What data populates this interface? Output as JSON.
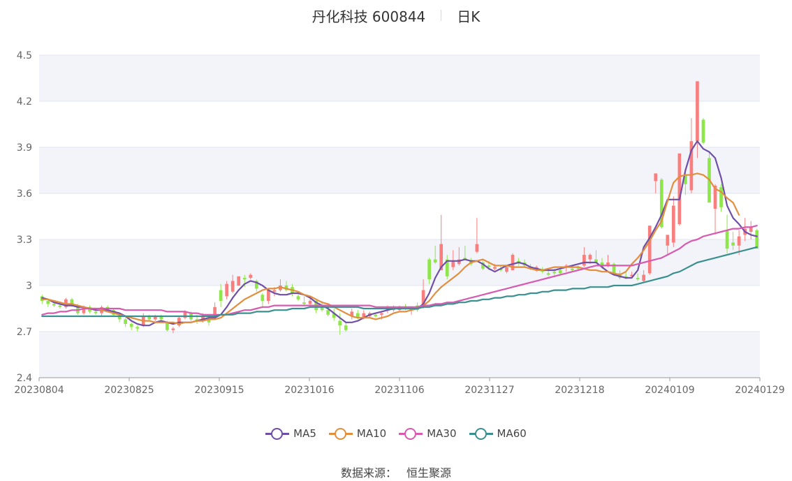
{
  "header": {
    "title": "丹化科技 600844",
    "period": "日K"
  },
  "source": {
    "label": "数据来源：",
    "value": "恒生聚源"
  },
  "chart_data": {
    "type": "candlestick",
    "ylim": [
      2.4,
      4.5
    ],
    "yticks": [
      "2.4",
      "2.7",
      "3",
      "3.3",
      "3.6",
      "3.9",
      "4.2",
      "4.5"
    ],
    "xticks": [
      "20230804",
      "20230825",
      "20230915",
      "20231016",
      "20231106",
      "20231127",
      "20231218",
      "20240109",
      "20240129"
    ],
    "grid": true,
    "up_color": "#f97f7f",
    "down_color": "#8ee64a",
    "candles_ohlc": [
      [
        2.93,
        2.94,
        2.88,
        2.9
      ],
      [
        2.9,
        2.91,
        2.86,
        2.88
      ],
      [
        2.88,
        2.9,
        2.86,
        2.87
      ],
      [
        2.87,
        2.89,
        2.85,
        2.86
      ],
      [
        2.86,
        2.92,
        2.85,
        2.91
      ],
      [
        2.91,
        2.92,
        2.86,
        2.87
      ],
      [
        2.87,
        2.88,
        2.81,
        2.82
      ],
      [
        2.82,
        2.87,
        2.81,
        2.86
      ],
      [
        2.86,
        2.87,
        2.82,
        2.83
      ],
      [
        2.83,
        2.85,
        2.81,
        2.82
      ],
      [
        2.82,
        2.87,
        2.8,
        2.86
      ],
      [
        2.86,
        2.87,
        2.83,
        2.84
      ],
      [
        2.84,
        2.85,
        2.8,
        2.81
      ],
      [
        2.81,
        2.82,
        2.76,
        2.78
      ],
      [
        2.78,
        2.79,
        2.73,
        2.75
      ],
      [
        2.75,
        2.76,
        2.71,
        2.73
      ],
      [
        2.73,
        2.74,
        2.7,
        2.72
      ],
      [
        2.74,
        2.82,
        2.73,
        2.8
      ],
      [
        2.8,
        2.81,
        2.77,
        2.78
      ],
      [
        2.78,
        2.81,
        2.77,
        2.8
      ],
      [
        2.8,
        2.81,
        2.77,
        2.78
      ],
      [
        2.76,
        2.77,
        2.7,
        2.71
      ],
      [
        2.71,
        2.73,
        2.69,
        2.72
      ],
      [
        2.74,
        2.8,
        2.73,
        2.79
      ],
      [
        2.79,
        2.84,
        2.78,
        2.83
      ],
      [
        2.82,
        2.83,
        2.77,
        2.78
      ],
      [
        2.78,
        2.81,
        2.75,
        2.77
      ],
      [
        2.78,
        2.82,
        2.76,
        2.8
      ],
      [
        2.78,
        2.8,
        2.74,
        2.76
      ],
      [
        2.8,
        2.89,
        2.79,
        2.86
      ],
      [
        2.97,
        3.01,
        2.86,
        2.9
      ],
      [
        2.93,
        3.03,
        2.91,
        3.01
      ],
      [
        2.96,
        3.07,
        2.95,
        3.03
      ],
      [
        3.0,
        3.06,
        3.0,
        3.06
      ],
      [
        3.05,
        3.07,
        2.99,
        3.04
      ],
      [
        3.05,
        3.08,
        3.04,
        3.07
      ],
      [
        3.03,
        3.04,
        2.96,
        2.98
      ],
      [
        2.94,
        2.95,
        2.86,
        2.9
      ],
      [
        2.9,
        2.98,
        2.88,
        2.97
      ],
      [
        2.96,
        2.99,
        2.93,
        2.97
      ],
      [
        2.97,
        3.04,
        2.96,
        3.0
      ],
      [
        3.0,
        3.03,
        2.96,
        2.97
      ],
      [
        2.99,
        3.01,
        2.93,
        2.95
      ],
      [
        2.93,
        2.96,
        2.9,
        2.91
      ],
      [
        2.89,
        2.93,
        2.87,
        2.88
      ],
      [
        2.88,
        2.92,
        2.86,
        2.9
      ],
      [
        2.9,
        2.91,
        2.82,
        2.84
      ],
      [
        2.86,
        2.9,
        2.83,
        2.84
      ],
      [
        2.84,
        2.86,
        2.8,
        2.81
      ],
      [
        2.82,
        2.85,
        2.77,
        2.79
      ],
      [
        2.77,
        2.82,
        2.68,
        2.74
      ],
      [
        2.74,
        2.76,
        2.7,
        2.71
      ],
      [
        2.8,
        2.85,
        2.78,
        2.83
      ],
      [
        2.82,
        2.84,
        2.78,
        2.79
      ],
      [
        2.79,
        2.84,
        2.78,
        2.82
      ],
      [
        2.8,
        2.83,
        2.79,
        2.82
      ],
      [
        2.81,
        2.82,
        2.79,
        2.8
      ],
      [
        2.81,
        2.83,
        2.78,
        2.82
      ],
      [
        2.84,
        2.87,
        2.82,
        2.86
      ],
      [
        2.84,
        2.87,
        2.83,
        2.86
      ],
      [
        2.84,
        2.87,
        2.83,
        2.86
      ],
      [
        2.86,
        2.88,
        2.84,
        2.85
      ],
      [
        2.84,
        2.86,
        2.81,
        2.85
      ],
      [
        2.87,
        2.89,
        2.83,
        2.84
      ],
      [
        2.86,
        3.04,
        2.85,
        2.97
      ],
      [
        3.17,
        3.18,
        3.01,
        3.04
      ],
      [
        3.17,
        3.26,
        3.14,
        3.15
      ],
      [
        3.1,
        3.46,
        3.1,
        3.27
      ],
      [
        3.17,
        3.2,
        3.04,
        3.06
      ],
      [
        3.12,
        3.23,
        3.1,
        3.16
      ],
      [
        3.14,
        3.25,
        3.13,
        3.17
      ],
      [
        3.18,
        3.26,
        3.17,
        3.17
      ],
      [
        3.16,
        3.18,
        3.13,
        3.14
      ],
      [
        3.22,
        3.44,
        3.21,
        3.27
      ],
      [
        3.15,
        3.16,
        3.1,
        3.11
      ],
      [
        3.13,
        3.16,
        3.1,
        3.12
      ],
      [
        3.11,
        3.14,
        3.1,
        3.12
      ],
      [
        3.11,
        3.13,
        3.09,
        3.1
      ],
      [
        3.09,
        3.13,
        3.08,
        3.12
      ],
      [
        3.1,
        3.21,
        3.1,
        3.2
      ],
      [
        3.16,
        3.18,
        3.13,
        3.15
      ],
      [
        3.15,
        3.17,
        3.12,
        3.13
      ],
      [
        3.12,
        3.14,
        3.1,
        3.11
      ],
      [
        3.1,
        3.13,
        3.09,
        3.12
      ],
      [
        3.1,
        3.12,
        3.08,
        3.09
      ],
      [
        3.08,
        3.1,
        3.06,
        3.07
      ],
      [
        3.09,
        3.11,
        3.06,
        3.08
      ],
      [
        3.1,
        3.12,
        3.07,
        3.08
      ],
      [
        3.12,
        3.14,
        3.09,
        3.13
      ],
      [
        3.11,
        3.13,
        3.09,
        3.1
      ],
      [
        3.12,
        3.13,
        3.1,
        3.11
      ],
      [
        3.13,
        3.25,
        3.12,
        3.2
      ],
      [
        3.17,
        3.21,
        3.14,
        3.2
      ],
      [
        3.17,
        3.23,
        3.16,
        3.15
      ],
      [
        3.15,
        3.18,
        3.11,
        3.12
      ],
      [
        3.13,
        3.2,
        3.12,
        3.15
      ],
      [
        3.14,
        3.15,
        3.07,
        3.08
      ],
      [
        3.08,
        3.1,
        3.04,
        3.05
      ],
      [
        3.06,
        3.09,
        3.04,
        3.05
      ],
      [
        3.06,
        3.09,
        3.05,
        3.07
      ],
      [
        3.05,
        3.08,
        3.03,
        3.04
      ],
      [
        3.03,
        3.1,
        3.02,
        3.07
      ],
      [
        3.08,
        3.39,
        3.07,
        3.39
      ],
      [
        3.68,
        3.73,
        3.6,
        3.73
      ],
      [
        3.69,
        3.7,
        3.37,
        3.38
      ],
      [
        3.26,
        3.33,
        3.2,
        3.33
      ],
      [
        3.28,
        3.58,
        3.25,
        3.52
      ],
      [
        3.4,
        3.86,
        3.39,
        3.86
      ],
      [
        3.72,
        3.74,
        3.59,
        3.66
      ],
      [
        3.62,
        4.09,
        3.6,
        3.94
      ],
      [
        3.94,
        4.33,
        3.83,
        4.33
      ],
      [
        4.08,
        4.09,
        3.92,
        3.93
      ],
      [
        3.83,
        3.87,
        3.54,
        3.54
      ],
      [
        3.5,
        3.66,
        3.33,
        3.65
      ],
      [
        3.64,
        3.66,
        3.48,
        3.51
      ],
      [
        3.36,
        3.46,
        3.21,
        3.24
      ],
      [
        3.28,
        3.35,
        3.23,
        3.26
      ],
      [
        3.26,
        3.36,
        3.2,
        3.32
      ],
      [
        3.33,
        3.44,
        3.29,
        3.37
      ],
      [
        3.35,
        3.42,
        3.3,
        3.38
      ],
      [
        3.36,
        3.37,
        3.24,
        3.24
      ]
    ],
    "series": [
      {
        "name": "MA5",
        "color": "#6f4fa8",
        "values": [
          2.92,
          2.91,
          2.89,
          2.88,
          2.87,
          2.87,
          2.86,
          2.86,
          2.85,
          2.84,
          2.84,
          2.84,
          2.83,
          2.82,
          2.8,
          2.77,
          2.75,
          2.74,
          2.74,
          2.76,
          2.77,
          2.76,
          2.75,
          2.76,
          2.76,
          2.76,
          2.77,
          2.78,
          2.79,
          2.79,
          2.81,
          2.86,
          2.92,
          2.97,
          3.01,
          3.03,
          3.02,
          3.0,
          2.97,
          2.95,
          2.94,
          2.94,
          2.95,
          2.95,
          2.94,
          2.92,
          2.89,
          2.87,
          2.85,
          2.82,
          2.79,
          2.76,
          2.76,
          2.77,
          2.79,
          2.81,
          2.82,
          2.83,
          2.84,
          2.85,
          2.85,
          2.85,
          2.85,
          2.85,
          2.88,
          2.95,
          3.05,
          3.12,
          3.16,
          3.16,
          3.16,
          3.17,
          3.16,
          3.16,
          3.14,
          3.11,
          3.09,
          3.11,
          3.13,
          3.14,
          3.15,
          3.14,
          3.12,
          3.11,
          3.1,
          3.1,
          3.1,
          3.11,
          3.12,
          3.13,
          3.14,
          3.15,
          3.15,
          3.15,
          3.12,
          3.09,
          3.07,
          3.06,
          3.05,
          3.05,
          3.1,
          3.25,
          3.31,
          3.38,
          3.46,
          3.56,
          3.56,
          3.56,
          3.75,
          3.88,
          3.94,
          3.89,
          3.87,
          3.83,
          3.7,
          3.52,
          3.44,
          3.4,
          3.35,
          3.33,
          3.32
        ]
      },
      {
        "name": "MA10",
        "color": "#e38e3d",
        "values": [
          2.91,
          2.91,
          2.9,
          2.89,
          2.88,
          2.88,
          2.87,
          2.86,
          2.85,
          2.85,
          2.84,
          2.83,
          2.82,
          2.81,
          2.8,
          2.79,
          2.78,
          2.77,
          2.77,
          2.76,
          2.76,
          2.76,
          2.76,
          2.75,
          2.76,
          2.76,
          2.77,
          2.77,
          2.78,
          2.78,
          2.79,
          2.82,
          2.85,
          2.88,
          2.91,
          2.93,
          2.95,
          2.97,
          2.98,
          2.98,
          2.99,
          2.98,
          2.97,
          2.96,
          2.94,
          2.93,
          2.91,
          2.89,
          2.88,
          2.86,
          2.84,
          2.82,
          2.8,
          2.79,
          2.79,
          2.79,
          2.78,
          2.79,
          2.8,
          2.82,
          2.83,
          2.83,
          2.84,
          2.85,
          2.87,
          2.9,
          2.95,
          2.99,
          3.02,
          3.05,
          3.08,
          3.12,
          3.15,
          3.16,
          3.17,
          3.15,
          3.13,
          3.13,
          3.13,
          3.12,
          3.12,
          3.12,
          3.11,
          3.1,
          3.1,
          3.11,
          3.12,
          3.12,
          3.12,
          3.12,
          3.12,
          3.11,
          3.1,
          3.1,
          3.09,
          3.09,
          3.08,
          3.07,
          3.09,
          3.14,
          3.18,
          3.23,
          3.29,
          3.36,
          3.42,
          3.55,
          3.67,
          3.71,
          3.72,
          3.72,
          3.73,
          3.72,
          3.69,
          3.63,
          3.61,
          3.57,
          3.54,
          3.46
        ]
      },
      {
        "name": "MA30",
        "color": "#d65ab0",
        "values": [
          2.81,
          2.82,
          2.82,
          2.83,
          2.83,
          2.84,
          2.84,
          2.85,
          2.85,
          2.85,
          2.85,
          2.85,
          2.85,
          2.85,
          2.84,
          2.84,
          2.84,
          2.84,
          2.84,
          2.84,
          2.84,
          2.83,
          2.83,
          2.83,
          2.83,
          2.82,
          2.82,
          2.81,
          2.81,
          2.81,
          2.81,
          2.81,
          2.82,
          2.83,
          2.84,
          2.84,
          2.85,
          2.86,
          2.86,
          2.87,
          2.87,
          2.87,
          2.87,
          2.87,
          2.87,
          2.87,
          2.87,
          2.87,
          2.87,
          2.87,
          2.87,
          2.87,
          2.87,
          2.87,
          2.87,
          2.87,
          2.86,
          2.86,
          2.86,
          2.86,
          2.86,
          2.86,
          2.86,
          2.86,
          2.87,
          2.87,
          2.88,
          2.88,
          2.89,
          2.89,
          2.9,
          2.91,
          2.92,
          2.93,
          2.94,
          2.95,
          2.96,
          2.97,
          2.98,
          2.99,
          3.0,
          3.01,
          3.02,
          3.03,
          3.04,
          3.05,
          3.06,
          3.07,
          3.08,
          3.09,
          3.1,
          3.11,
          3.12,
          3.13,
          3.13,
          3.13,
          3.13,
          3.13,
          3.13,
          3.13,
          3.14,
          3.15,
          3.16,
          3.17,
          3.18,
          3.2,
          3.22,
          3.24,
          3.27,
          3.29,
          3.3,
          3.32,
          3.33,
          3.34,
          3.35,
          3.36,
          3.37,
          3.37,
          3.38,
          3.38,
          3.39
        ]
      },
      {
        "name": "MA60",
        "color": "#3a8f8f",
        "values": [
          2.8,
          2.8,
          2.8,
          2.8,
          2.8,
          2.8,
          2.8,
          2.8,
          2.8,
          2.8,
          2.8,
          2.8,
          2.8,
          2.8,
          2.8,
          2.8,
          2.8,
          2.8,
          2.8,
          2.8,
          2.8,
          2.8,
          2.8,
          2.8,
          2.8,
          2.8,
          2.8,
          2.8,
          2.8,
          2.8,
          2.81,
          2.81,
          2.81,
          2.82,
          2.82,
          2.82,
          2.83,
          2.83,
          2.83,
          2.84,
          2.84,
          2.84,
          2.85,
          2.85,
          2.85,
          2.86,
          2.86,
          2.86,
          2.86,
          2.86,
          2.86,
          2.86,
          2.86,
          2.86,
          2.85,
          2.85,
          2.85,
          2.85,
          2.85,
          2.85,
          2.85,
          2.85,
          2.85,
          2.85,
          2.86,
          2.86,
          2.87,
          2.87,
          2.88,
          2.88,
          2.89,
          2.89,
          2.9,
          2.9,
          2.91,
          2.91,
          2.92,
          2.92,
          2.93,
          2.93,
          2.94,
          2.94,
          2.95,
          2.95,
          2.96,
          2.96,
          2.97,
          2.97,
          2.97,
          2.98,
          2.98,
          2.98,
          2.99,
          2.99,
          2.99,
          2.99,
          3.0,
          3.0,
          3.0,
          3.0,
          3.01,
          3.02,
          3.03,
          3.04,
          3.05,
          3.06,
          3.08,
          3.09,
          3.11,
          3.13,
          3.15,
          3.16,
          3.17,
          3.18,
          3.19,
          3.2,
          3.21,
          3.22,
          3.23,
          3.24,
          3.25
        ]
      }
    ]
  }
}
